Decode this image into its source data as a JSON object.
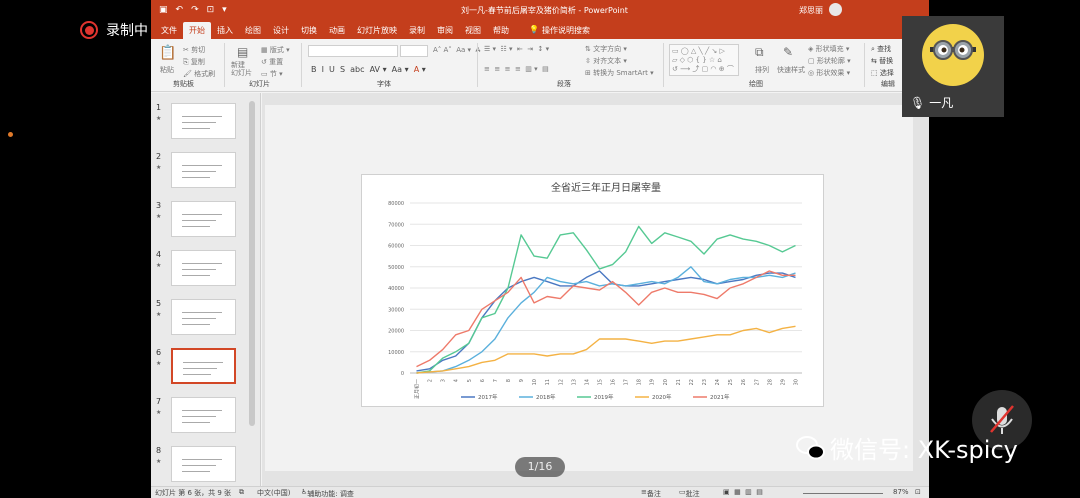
{
  "recorder": {
    "label": "录制中"
  },
  "window": {
    "title": "刘一凡-春节前后屠宰及猪价简析 - PowerPoint",
    "user": "郑思丽"
  },
  "menu": {
    "tabs": [
      "文件",
      "开始",
      "插入",
      "绘图",
      "设计",
      "切换",
      "动画",
      "幻灯片放映",
      "录制",
      "审阅",
      "视图",
      "帮助"
    ],
    "active_index": 1,
    "search": "操作说明搜索"
  },
  "ribbon": {
    "groups": [
      "剪贴板",
      "幻灯片",
      "字体",
      "段落",
      "绘图",
      "编辑"
    ],
    "clipboard": {
      "paste": "粘贴",
      "cut": "剪切",
      "copy": "复制",
      "format": "格式刷"
    },
    "slides": {
      "new_slide": "新建\n幻灯片",
      "layout": "版式",
      "reset": "重置",
      "section": "节"
    },
    "paragraph": {
      "text_direction": "文字方向",
      "align_text": "对齐文本",
      "smartart": "转换为 SmartArt"
    },
    "drawing": {
      "arrange": "排列",
      "quick_styles": "快速样式",
      "fill": "形状填充",
      "outline": "形状轮廓",
      "effects": "形状效果"
    },
    "editing": {
      "find": "查找",
      "replace": "替换",
      "select": "选择"
    }
  },
  "thumbnails": [
    {
      "number": "1"
    },
    {
      "number": "2"
    },
    {
      "number": "3"
    },
    {
      "number": "4"
    },
    {
      "number": "5"
    },
    {
      "number": "6",
      "selected": true
    },
    {
      "number": "7"
    },
    {
      "number": "8"
    }
  ],
  "pager": {
    "label": "1/16"
  },
  "status": {
    "slide_info": "幻灯片 第 6 张，共 9 张",
    "language": "中文(中国)",
    "accessibility": "辅助功能: 调查",
    "notes": "备注",
    "comments": "批注",
    "zoom": "87%"
  },
  "camera": {
    "name": "一凡"
  },
  "watermark": {
    "text": "微信号: XK-spicy"
  },
  "colors": {
    "ppt_red": "#c43e1c",
    "s2017": "#4a78c2",
    "s2018": "#5bb0dc",
    "s2019": "#56c993",
    "s2020": "#f4b244",
    "s2021": "#ee7a6a"
  },
  "chart_data": {
    "type": "line",
    "title": "全省近三年正月日屠宰量",
    "x_first_label": "正月初一",
    "x": [
      "正月初一",
      "2",
      "3",
      "4",
      "5",
      "6",
      "7",
      "8",
      "9",
      "10",
      "11",
      "12",
      "13",
      "14",
      "15",
      "16",
      "17",
      "18",
      "19",
      "20",
      "21",
      "22",
      "23",
      "24",
      "25",
      "26",
      "27",
      "28",
      "29",
      "30"
    ],
    "ylim": [
      0,
      80000
    ],
    "yticks": [
      "0",
      "10000",
      "20000",
      "30000",
      "40000",
      "50000",
      "60000",
      "70000",
      "80000"
    ],
    "grid": true,
    "legend": "bottom",
    "series": [
      {
        "name": "2017年",
        "values": [
          1000,
          2000,
          6000,
          8000,
          14000,
          26000,
          34000,
          40000,
          43000,
          45000,
          43000,
          41000,
          41000,
          45000,
          48000,
          42000,
          41000,
          41000,
          42000,
          43000,
          44000,
          45000,
          44000,
          42000,
          43000,
          44000,
          46000,
          47000,
          47000,
          45000
        ]
      },
      {
        "name": "2018年",
        "values": [
          0,
          500,
          1000,
          3000,
          6000,
          10000,
          16000,
          26000,
          33000,
          38000,
          45000,
          43000,
          42000,
          43000,
          41000,
          42000,
          41000,
          42000,
          43000,
          42000,
          45000,
          50000,
          43000,
          42000,
          44000,
          45000,
          45000,
          46000,
          45000,
          47000
        ]
      },
      {
        "name": "2019年",
        "values": [
          0,
          1000,
          7000,
          10000,
          14000,
          26000,
          28000,
          40000,
          65000,
          55000,
          54000,
          65000,
          66000,
          58000,
          49000,
          51000,
          57000,
          69000,
          61000,
          66000,
          64000,
          62000,
          56000,
          63000,
          65000,
          63000,
          62000,
          60000,
          57000,
          60000
        ]
      },
      {
        "name": "2020年",
        "values": [
          0,
          500,
          1000,
          2000,
          3000,
          5000,
          6000,
          9000,
          9000,
          9000,
          8000,
          9000,
          9000,
          11000,
          16000,
          16000,
          16000,
          15000,
          14000,
          15000,
          15000,
          16000,
          17000,
          18000,
          18000,
          20000,
          21000,
          19000,
          21000,
          22000
        ]
      },
      {
        "name": "2021年",
        "values": [
          3000,
          6000,
          11000,
          18000,
          20000,
          30000,
          34000,
          38000,
          45000,
          33000,
          36000,
          35000,
          41000,
          40000,
          39000,
          43000,
          38000,
          32000,
          38000,
          40000,
          38000,
          38000,
          37000,
          35000,
          40000,
          42000,
          45000,
          48000,
          46000,
          46000
        ]
      }
    ]
  }
}
